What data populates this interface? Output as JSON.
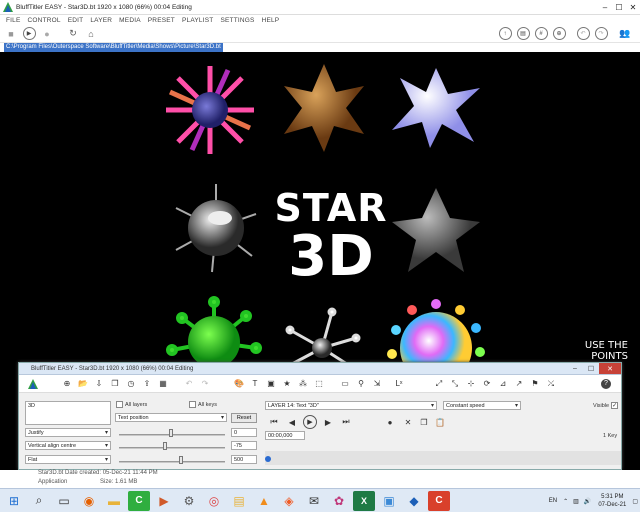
{
  "window": {
    "title": "BluffTitler EASY - Star3D.bt 1920 x 1080 (66%) 00:04 Editing"
  },
  "menu": [
    "FILE",
    "CONTROL",
    "EDIT",
    "LAYER",
    "MEDIA",
    "PRESET",
    "PLAYLIST",
    "SETTINGS",
    "HELP"
  ],
  "path": "C:\\Program Files\\Outerspace Software\\BluffTitler\\Media\\Shows\\Picture\\Star3D.bt",
  "canvas": {
    "title_line1": "STAR",
    "title_line2": "3D",
    "hint": "USE THE\nPOINTS"
  },
  "panel": {
    "title": "BluffTitler EASY - Star3D.bt 1920 x 1080 (66%) 00:04 Editing",
    "text_value": "3D",
    "all_layers": "All layers",
    "all_keys": "All keys",
    "property_select": "Text position",
    "reset": "Reset",
    "justify": "Justify",
    "vertical_align": "Vertical align centre",
    "flat": "Flat",
    "value1": "0",
    "value2": "-75",
    "value3": "500",
    "layer_select": "LAYER    14: Text \"3D\"",
    "speed_select": "Constant speed",
    "visible": "Visible",
    "time": "00:00,000",
    "keys": "1 Key"
  },
  "status": {
    "line1": "Star3D.bt    Date created: 05-Dec-21 11:44 PM",
    "line2": "Application",
    "line3": "Size: 1.61 MB"
  },
  "taskbar": {
    "lang": "EN",
    "time": "5:31 PM",
    "date": "07-Dec-21"
  }
}
